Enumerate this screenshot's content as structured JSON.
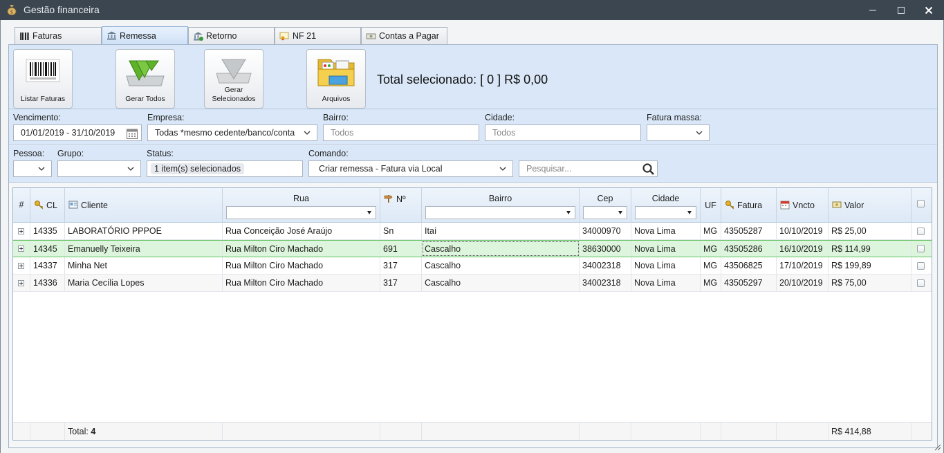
{
  "window": {
    "title": "Gestão financeira",
    "minimize_glyph": "—",
    "maximize_glyph": "☐",
    "close_glyph": "✕"
  },
  "tabs": [
    {
      "label": "Faturas",
      "icon": "barcode-icon"
    },
    {
      "label": "Remessa",
      "icon": "bank-icon"
    },
    {
      "label": "Retorno",
      "icon": "bank-return-icon"
    },
    {
      "label": "NF 21",
      "icon": "certificate-icon"
    },
    {
      "label": "Contas a Pagar",
      "icon": "money-icon"
    }
  ],
  "active_tab": "Remessa",
  "toolbar": {
    "listar_faturas": "Listar Faturas",
    "gerar_todos": "Gerar Todos",
    "gerar_selecionados": "Gerar Selecionados",
    "arquivos": "Arquivos",
    "total_selecionado": "Total selecionado: [ 0 ] R$ 0,00"
  },
  "filters": {
    "vencimento_label": "Vencimento:",
    "vencimento_value": "01/01/2019 - 31/10/2019",
    "empresa_label": "Empresa:",
    "empresa_value": "Todas *mesmo cedente/banco/conta",
    "bairro_label": "Bairro:",
    "bairro_placeholder": "Todos",
    "cidade_label": "Cidade:",
    "cidade_placeholder": "Todos",
    "fatura_massa_label": "Fatura massa:",
    "fatura_massa_value": "",
    "pessoa_label": "Pessoa:",
    "pessoa_value": "",
    "grupo_label": "Grupo:",
    "grupo_value": "",
    "status_label": "Status:",
    "status_value": "1 item(s) selecionados",
    "comando_label": "Comando:",
    "comando_value": "Criar remessa - Fatura via Local",
    "pesquisar_placeholder": "Pesquisar..."
  },
  "grid": {
    "columns": {
      "num": "#",
      "cl": "CL",
      "cliente": "Cliente",
      "rua": "Rua",
      "numero": "Nº",
      "bairro": "Bairro",
      "cep": "Cep",
      "cidade": "Cidade",
      "uf": "UF",
      "fatura": "Fatura",
      "vencto": "Vncto",
      "valor": "Valor"
    },
    "rows": [
      {
        "cl": "14335",
        "cliente": "LABORATÓRIO PPPOE",
        "rua": "Rua Conceição José Araújo",
        "numero": "Sn",
        "bairro": "Itaí",
        "cep": "34000970",
        "cidade": "Nova Lima",
        "uf": "MG",
        "fatura": "43505287",
        "vencto": "10/10/2019",
        "valor": "R$ 25,00"
      },
      {
        "cl": "14345",
        "cliente": "Emanuelly Teixeira",
        "rua": "Rua Milton Ciro Machado",
        "numero": "691",
        "bairro": "Cascalho",
        "cep": "38630000",
        "cidade": "Nova Lima",
        "uf": "MG",
        "fatura": "43505286",
        "vencto": "16/10/2019",
        "valor": "R$ 114,99"
      },
      {
        "cl": "14337",
        "cliente": "Minha Net",
        "rua": "Rua Milton Ciro Machado",
        "numero": "317",
        "bairro": "Cascalho",
        "cep": "34002318",
        "cidade": "Nova Lima",
        "uf": "MG",
        "fatura": "43506825",
        "vencto": "17/10/2019",
        "valor": "R$ 199,89"
      },
      {
        "cl": "14336",
        "cliente": "Maria Cecília Lopes",
        "rua": "Rua Milton Ciro Machado",
        "numero": "317",
        "bairro": "Cascalho",
        "cep": "34002318",
        "cidade": "Nova Lima",
        "uf": "MG",
        "fatura": "43505297",
        "vencto": "20/10/2019",
        "valor": "R$ 75,00"
      }
    ],
    "selected_row": 1,
    "footer": {
      "total_label": "Total:",
      "total_count": "4",
      "total_valor": "R$ 414,88"
    }
  },
  "colors": {
    "titlebar": "#3c4650",
    "panel": "#d9e7f8",
    "selected_row": "#ddf5dc",
    "selected_border": "#5fbf5f"
  }
}
